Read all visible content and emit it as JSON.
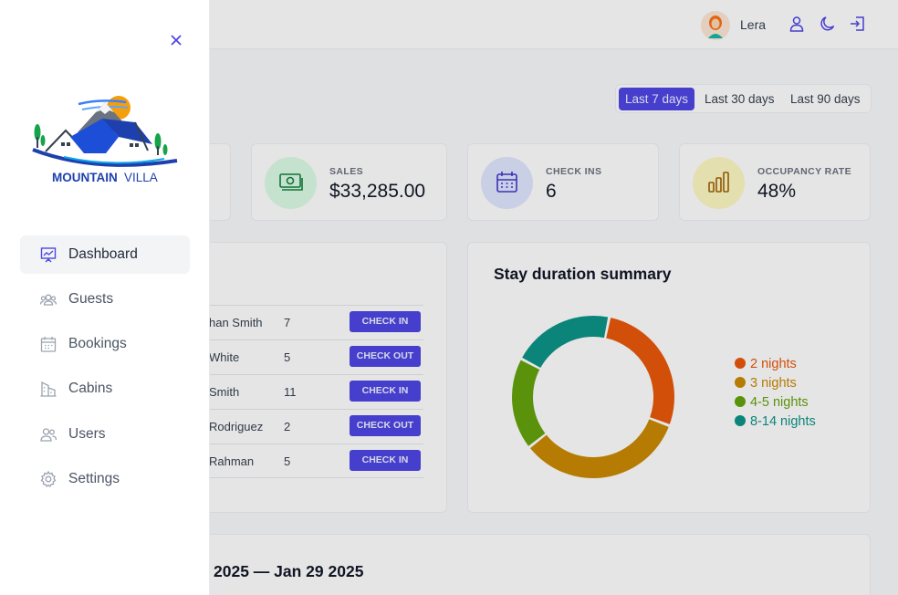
{
  "header": {
    "user_name": "Lera"
  },
  "filter": {
    "options": [
      "Last 7 days",
      "Last 30 days",
      "Last 90 days"
    ],
    "selected": "Last 7 days"
  },
  "stats": [
    {
      "label": "SALES",
      "value": "$33,285.00",
      "icon": "banknotes-icon",
      "color": "#dcfce7"
    },
    {
      "label": "CHECK INS",
      "value": "6",
      "icon": "calendar-icon",
      "color": "#e0e7ff"
    },
    {
      "label": "OCCUPANCY RATE",
      "value": "48%",
      "icon": "chart-bar-icon",
      "color": "#fef9c3"
    }
  ],
  "activity": {
    "rows": [
      {
        "name": "han Smith",
        "nights": "7",
        "action": "CHECK IN"
      },
      {
        "name": "White",
        "nights": "5",
        "action": "CHECK OUT"
      },
      {
        "name": "Smith",
        "nights": "11",
        "action": "CHECK IN"
      },
      {
        "name": "Rodriguez",
        "nights": "2",
        "action": "CHECK OUT"
      },
      {
        "name": "Rahman",
        "nights": "5",
        "action": "CHECK IN"
      }
    ]
  },
  "duration": {
    "title": "Stay duration summary"
  },
  "chart_data": {
    "type": "pie",
    "title": "Stay duration summary",
    "categories": [
      "2 nights",
      "3 nights",
      "4-5 nights",
      "8-14 nights"
    ],
    "values": [
      27,
      33,
      18,
      20
    ],
    "colors": [
      "#ea580c",
      "#ca8a04",
      "#65a30d",
      "#0d9488"
    ],
    "legend": "right"
  },
  "sales_chart": {
    "title_partial": "2025 — Jan 29 2025"
  },
  "sidebar": {
    "brand": "MOUNTAIN VILLA",
    "brand_part1": "MOUNTAIN",
    "brand_part2": "VILLA",
    "items": [
      {
        "label": "Dashboard",
        "icon": "chart-presentation-icon",
        "active": true
      },
      {
        "label": "Guests",
        "icon": "users-group-icon",
        "active": false
      },
      {
        "label": "Bookings",
        "icon": "calendar-icon",
        "active": false
      },
      {
        "label": "Cabins",
        "icon": "building-icon",
        "active": false
      },
      {
        "label": "Users",
        "icon": "users-icon",
        "active": false
      },
      {
        "label": "Settings",
        "icon": "gear-icon",
        "active": false
      }
    ]
  },
  "colors": {
    "brand": "#4f46e5",
    "brand_dark": "#1e40af"
  }
}
